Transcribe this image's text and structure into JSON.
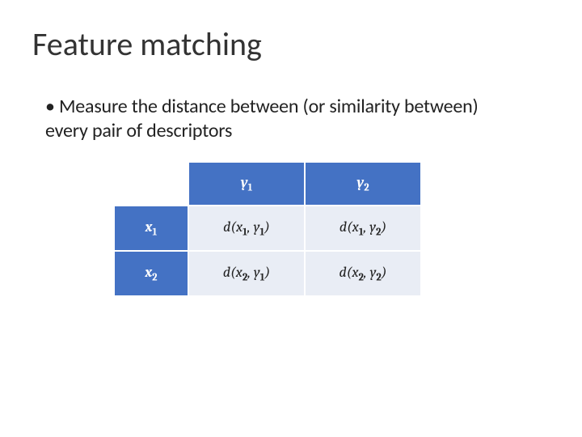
{
  "title": "Feature matching",
  "bullet": "Measure the distance between (or similarity between) every pair of descriptors",
  "table": {
    "col_headers": [
      {
        "var": "y",
        "sub": "1"
      },
      {
        "var": "y",
        "sub": "2"
      }
    ],
    "row_headers": [
      {
        "var": "x",
        "sub": "1"
      },
      {
        "var": "x",
        "sub": "2"
      }
    ],
    "cells": [
      [
        {
          "func": "d",
          "a_var": "x",
          "a_sub": "1",
          "b_var": "y",
          "b_sub": "1"
        },
        {
          "func": "d",
          "a_var": "x",
          "a_sub": "1",
          "b_var": "y",
          "b_sub": "2"
        }
      ],
      [
        {
          "func": "d",
          "a_var": "x",
          "a_sub": "2",
          "b_var": "y",
          "b_sub": "1"
        },
        {
          "func": "d",
          "a_var": "x",
          "a_sub": "2",
          "b_var": "y",
          "b_sub": "2"
        }
      ]
    ]
  }
}
